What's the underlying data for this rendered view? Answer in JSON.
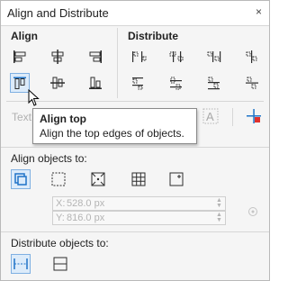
{
  "title": "Align and Distribute",
  "close_glyph": "×",
  "sections": {
    "align": "Align",
    "distribute": "Distribute"
  },
  "align_icons": [
    "align-left-icon",
    "align-center-horizontal-icon",
    "align-right-icon",
    "align-top-icon",
    "align-center-vertical-icon",
    "align-bottom-icon"
  ],
  "distribute_icons": [
    "distribute-left-icon",
    "distribute-center-icon",
    "distribute-right-icon",
    "distribute-spacing-horizontal-icon",
    "distribute-top-icon",
    "distribute-middle-icon",
    "distribute-bottom-icon",
    "distribute-spacing-vertical-icon"
  ],
  "text_label": "Text",
  "tooltip": {
    "title": "Align top",
    "description": "Align the top edges of objects."
  },
  "align_objects_to": {
    "label": "Align objects to:",
    "x_axis": "X:",
    "x_value": "528.0 px",
    "y_axis": "Y:",
    "y_value": "816.0 px"
  },
  "distribute_objects_to": {
    "label": "Distribute objects to:"
  },
  "colors": {
    "accent_blue": "#1e73c8",
    "active_bg": "#dcebfa",
    "icon_dark": "#2d2d2d"
  }
}
